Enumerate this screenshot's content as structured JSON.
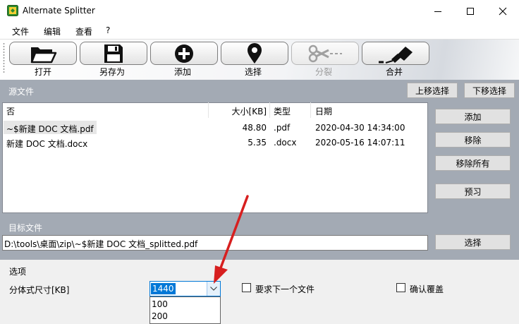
{
  "window": {
    "title": "Alternate Splitter",
    "app_icon": "app-icon",
    "controls": [
      "minimize",
      "maximize",
      "close"
    ]
  },
  "menu": {
    "items": [
      "文件",
      "编辑",
      "查看",
      "?"
    ]
  },
  "toolbar": {
    "buttons": [
      {
        "label": "打开",
        "icon": "folder-open-icon",
        "enabled": true
      },
      {
        "label": "另存为",
        "icon": "floppy-disk-icon",
        "enabled": true
      },
      {
        "label": "添加",
        "icon": "plus-circle-icon",
        "enabled": true
      },
      {
        "label": "选择",
        "icon": "map-pin-icon",
        "enabled": true
      },
      {
        "label": "分裂",
        "icon": "scissors-icon",
        "enabled": false
      },
      {
        "label": "合并",
        "icon": "glue-bottle-icon",
        "enabled": true
      }
    ]
  },
  "source": {
    "label": "源文件",
    "move_up_label": "上移选择",
    "move_down_label": "下移选择",
    "columns": [
      "否",
      "大小[KB]",
      "类型",
      "日期"
    ],
    "rows": [
      {
        "name": "~$新建 DOC 文档.pdf",
        "size": "48.80",
        "type": ".pdf",
        "date": "2020-04-30 14:34:00"
      },
      {
        "name": "新建 DOC 文档.docx",
        "size": "5.35",
        "type": ".docx",
        "date": "2020-05-16 14:07:11"
      }
    ],
    "side_buttons": [
      "添加",
      "移除",
      "移除所有",
      "预习"
    ]
  },
  "target": {
    "label": "目标文件",
    "path": "D:\\tools\\桌面\\zip\\~$新建 DOC 文档_splitted.pdf",
    "browse_label": "选择"
  },
  "options": {
    "label": "选项",
    "part_size_label": "分体式尺寸[KB]",
    "part_size_value": "1440",
    "dropdown_options": [
      "100",
      "200"
    ],
    "require_next_file_label": "要求下一个文件",
    "confirm_overwrite_label": "确认覆盖"
  },
  "colors": {
    "band": "#a3aab4",
    "selection_blue": "#0078d7",
    "arrow_red": "#d71f1f"
  }
}
